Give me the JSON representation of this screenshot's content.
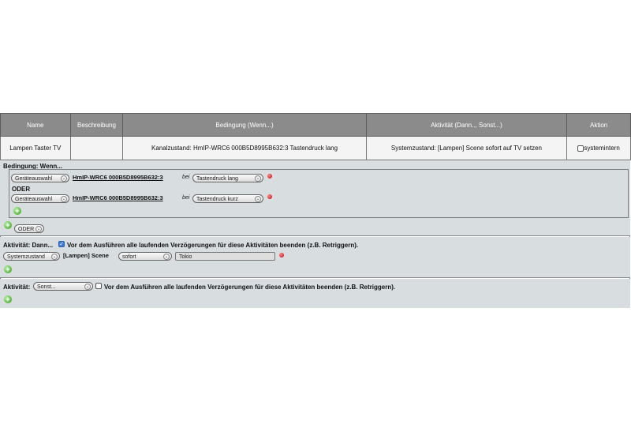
{
  "columns": [
    "Name",
    "Beschreibung",
    "Bedingung (Wenn...)",
    "Aktivität (Dann.., Sonst...)",
    "Aktion"
  ],
  "row": {
    "name": "Lampen Taster TV",
    "description": "",
    "condition": "Kanalzustand: HmIP-WRC6 000B5D8995B632:3 Tastendruck lang",
    "activity": "Systemzustand: [Lampen] Scene sofort auf TV setzen",
    "action_checkbox_label": "systemintern",
    "action_checked": false
  },
  "condition_section": {
    "title": "Bedingung: Wenn...",
    "rows": [
      {
        "select": "Geräteauswahl",
        "device": "HmIP-WRC6 000B5D8995B632:3",
        "bei": "bei",
        "trigger": "Tastendruck lang"
      },
      {
        "select": "Geräteauswahl",
        "device": "HmIP-WRC6 000B5D8995B632:3",
        "bei": "bei",
        "trigger": "Tastendruck kurz"
      }
    ],
    "or_label": "ODER",
    "or_select": "ODER"
  },
  "then_section": {
    "label": "Aktivität: Dann...",
    "checked": true,
    "checkbox_text": "Vor dem Ausführen alle laufenden Verzögerungen für diese Aktivitäten beenden (z.B. Retriggern).",
    "select": "Systemzustand",
    "target": "[Lampen] Scene",
    "timing": "sofort",
    "value": "Tokio"
  },
  "else_section": {
    "label": "Aktivität:",
    "select": "Sonst...",
    "checked": false,
    "checkbox_text": "Vor dem Ausführen alle laufenden Verzögerungen für diese Aktivitäten beenden (z.B. Retriggern)."
  },
  "icons": {
    "add": "add-icon",
    "delete": "delete-icon",
    "dropdown": "chevron-down-icon"
  },
  "colors": {
    "header_bg": "#8b8b8b",
    "panel_bg": "#d8dde0",
    "add_green": "#2e9a14",
    "delete_red": "#c00000"
  }
}
